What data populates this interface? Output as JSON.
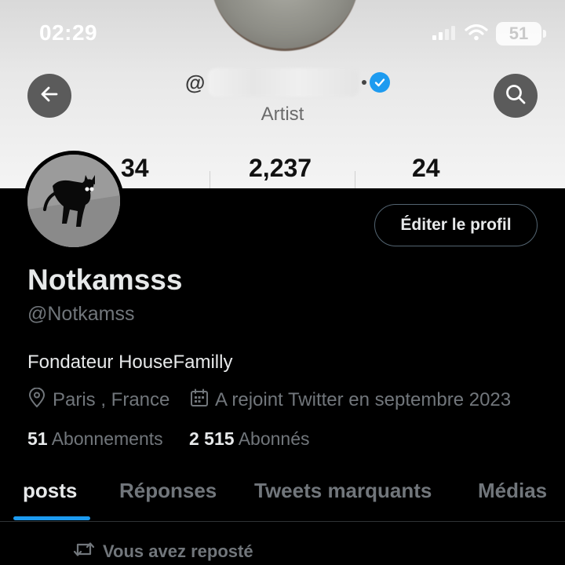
{
  "status_bar": {
    "time": "02:29",
    "battery": "51"
  },
  "banner": {
    "at_symbol": "@",
    "subtitle": "Artist",
    "stats": [
      "34",
      "2,237",
      "24"
    ]
  },
  "profile": {
    "edit_label": "Éditer le profil",
    "display_name": "Notkamsss",
    "handle": "@Notkamss",
    "bio": "Fondateur HouseFamilly",
    "location": "Paris , France",
    "joined": "A rejoint Twitter en septembre 2023",
    "following_count": "51",
    "following_label": "Abonnements",
    "followers_count": "2 515",
    "followers_label": "Abonnés"
  },
  "tabs": [
    {
      "label": "posts",
      "active": true
    },
    {
      "label": "Réponses"
    },
    {
      "label": "Tweets marquants"
    },
    {
      "label": "Médias"
    }
  ],
  "repost_banner": "Vous avez reposté",
  "colors": {
    "accent": "#1d9bf0",
    "muted": "#71767b",
    "background": "#000000"
  },
  "icons": [
    "back-arrow-icon",
    "search-icon",
    "verified-icon",
    "wifi-icon",
    "signal-icon",
    "location-pin-icon",
    "calendar-icon",
    "repost-icon"
  ]
}
